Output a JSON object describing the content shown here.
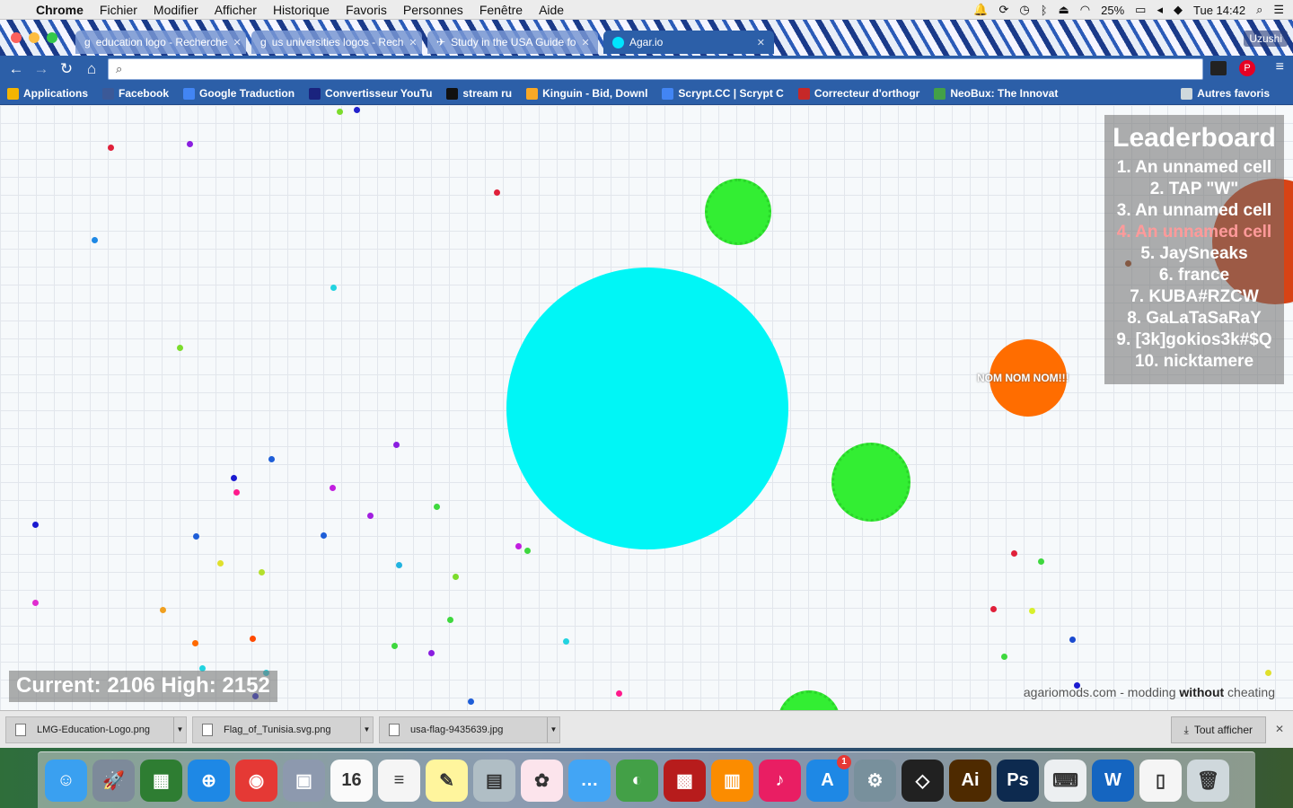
{
  "menubar": {
    "app": "Chrome",
    "items": [
      "Fichier",
      "Modifier",
      "Afficher",
      "Historique",
      "Favoris",
      "Personnes",
      "Fenêtre",
      "Aide"
    ],
    "battery": "25%",
    "clock": "Tue 14:42"
  },
  "tabs": [
    {
      "title": "education logo - Recherche",
      "active": false
    },
    {
      "title": "us universities logos - Rech",
      "active": false
    },
    {
      "title": "Study in the USA Guide fo",
      "active": false
    },
    {
      "title": "Agar.io",
      "active": true
    }
  ],
  "profile": "Uzushi",
  "omnibox": {
    "value": ""
  },
  "bookmarks": [
    {
      "label": "Applications",
      "color": "#f4b400"
    },
    {
      "label": "Facebook",
      "color": "#3b5998"
    },
    {
      "label": "Google Traduction",
      "color": "#4285f4"
    },
    {
      "label": "Convertisseur YouTu",
      "color": "#1a237e"
    },
    {
      "label": "stream ru",
      "color": "#111111"
    },
    {
      "label": "Kinguin - Bid, Downl",
      "color": "#f9a825"
    },
    {
      "label": "Scrypt.CC | Scrypt C",
      "color": "#4285f4"
    },
    {
      "label": "Correcteur d'orthogr",
      "color": "#c62828"
    },
    {
      "label": "NeoBux: The Innovat",
      "color": "#43a047"
    }
  ],
  "other_bookmarks": "Autres favoris",
  "leaderboard": {
    "title": "Leaderboard",
    "entries": [
      "1. An unnamed cell",
      "2. TAP \"W\"",
      "3. An unnamed cell",
      "4. An unnamed cell",
      "5. JaySneaks",
      "6. france",
      "7. KUBA#RZCW",
      "8. GaLaTaSaRaY",
      "9. [3k]gokios3k#$Q",
      "10. nicktamere"
    ],
    "highlight_rank": 4
  },
  "score": {
    "text": "Current: 2106  High: 2152"
  },
  "credit": {
    "prefix": "agariomods.com - modding ",
    "bold": "without",
    "suffix": " cheating"
  },
  "cell_label": "NOM NOM NOM!!!",
  "downloads": [
    {
      "file": "LMG-Education-Logo.png"
    },
    {
      "file": "Flag_of_Tunisia.svg.png"
    },
    {
      "file": "usa-flag-9435639.jpg"
    }
  ],
  "show_all": "Tout afficher",
  "dock": [
    {
      "name": "finder",
      "color": "#3aa0f0",
      "glyph": "☺"
    },
    {
      "name": "launchpad",
      "color": "#7d8a9a",
      "glyph": "🚀"
    },
    {
      "name": "mission-control",
      "color": "#2e7d32",
      "glyph": "▦"
    },
    {
      "name": "safari",
      "color": "#1e88e5",
      "glyph": "⊕"
    },
    {
      "name": "chrome",
      "color": "#e53935",
      "glyph": "◉"
    },
    {
      "name": "preview",
      "color": "#8d99ae",
      "glyph": "▣"
    },
    {
      "name": "calendar",
      "color": "#fafafa",
      "glyph": "16"
    },
    {
      "name": "reminders",
      "color": "#f5f5f5",
      "glyph": "≡"
    },
    {
      "name": "notes",
      "color": "#fff59d",
      "glyph": "✎"
    },
    {
      "name": "system-info",
      "color": "#b0bec5",
      "glyph": "▤"
    },
    {
      "name": "photos",
      "color": "#fce4ec",
      "glyph": "✿"
    },
    {
      "name": "messages",
      "color": "#42a5f5",
      "glyph": "…"
    },
    {
      "name": "facetime",
      "color": "#43a047",
      "glyph": "◐"
    },
    {
      "name": "photo-booth",
      "color": "#b71c1c",
      "glyph": "▩"
    },
    {
      "name": "ibooks",
      "color": "#fb8c00",
      "glyph": "▥"
    },
    {
      "name": "itunes",
      "color": "#e91e63",
      "glyph": "♪"
    },
    {
      "name": "app-store",
      "color": "#1e88e5",
      "glyph": "A",
      "badge": "1"
    },
    {
      "name": "system-preferences",
      "color": "#78909c",
      "glyph": "⚙"
    },
    {
      "name": "unity",
      "color": "#212121",
      "glyph": "◇"
    },
    {
      "name": "illustrator",
      "color": "#4e2a00",
      "glyph": "Ai"
    },
    {
      "name": "photoshop",
      "color": "#0d2a4f",
      "glyph": "Ps"
    },
    {
      "name": "keyboard-viewer",
      "color": "#eceff1",
      "glyph": "⌨"
    },
    {
      "name": "word",
      "color": "#1565c0",
      "glyph": "W"
    },
    {
      "name": "document",
      "color": "#f5f5f5",
      "glyph": "▯"
    },
    {
      "name": "trash",
      "color": "#cfd8dc",
      "glyph": "🗑"
    }
  ],
  "colors": {
    "player_cell": "#00f6f6",
    "virus": "#33ee33",
    "orange_cell": "#ff6d00",
    "far_cell": "#d84315"
  }
}
